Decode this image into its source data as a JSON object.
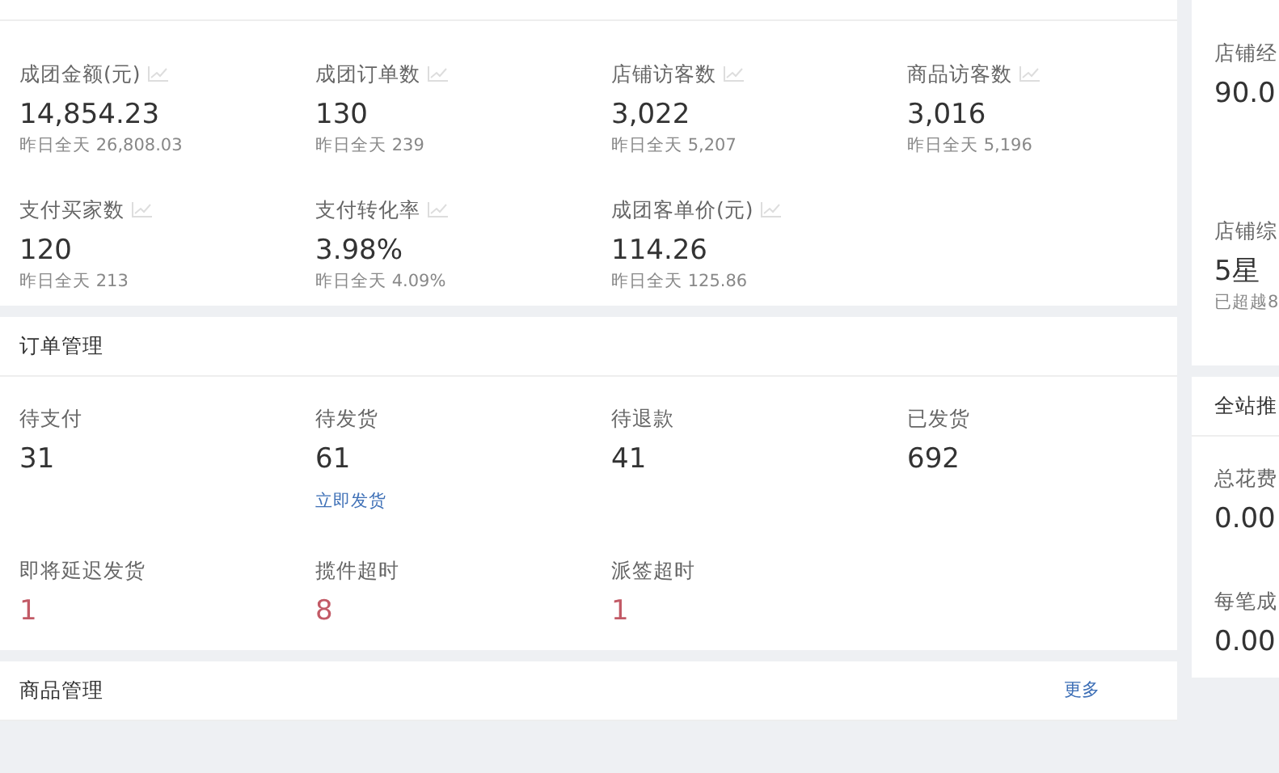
{
  "overview": {
    "metrics": [
      {
        "label": "成团金额(元)",
        "value": "14,854.23",
        "yesterday": "昨日全天 26,808.03"
      },
      {
        "label": "成团订单数",
        "value": "130",
        "yesterday": "昨日全天 239"
      },
      {
        "label": "店铺访客数",
        "value": "3,022",
        "yesterday": "昨日全天 5,207"
      },
      {
        "label": "商品访客数",
        "value": "3,016",
        "yesterday": "昨日全天 5,196"
      },
      {
        "label": "支付买家数",
        "value": "120",
        "yesterday": "昨日全天 213"
      },
      {
        "label": "支付转化率",
        "value": "3.98%",
        "yesterday": "昨日全天 4.09%"
      },
      {
        "label": "成团客单价(元)",
        "value": "114.26",
        "yesterday": "昨日全天 125.86"
      }
    ]
  },
  "orders": {
    "title": "订单管理",
    "items": [
      {
        "label": "待支付",
        "value": "31",
        "alert": false
      },
      {
        "label": "待发货",
        "value": "61",
        "alert": false,
        "action": "立即发货"
      },
      {
        "label": "待退款",
        "value": "41",
        "alert": false
      },
      {
        "label": "已发货",
        "value": "692",
        "alert": false
      },
      {
        "label": "即将延迟发货",
        "value": "1",
        "alert": true
      },
      {
        "label": "揽件超时",
        "value": "8",
        "alert": true
      },
      {
        "label": "派签超时",
        "value": "1",
        "alert": true
      }
    ]
  },
  "products": {
    "title": "商品管理",
    "more": "更多"
  },
  "side": {
    "shop_items": [
      {
        "label": "店铺经",
        "value": "90.0"
      },
      {
        "label": "店铺综",
        "value": "5星",
        "note": "已超越8"
      }
    ],
    "promo": {
      "title": "全站推",
      "items": [
        {
          "label": "总花费",
          "value": "0.00"
        },
        {
          "label": "每笔成",
          "value": "0.00"
        }
      ]
    }
  }
}
